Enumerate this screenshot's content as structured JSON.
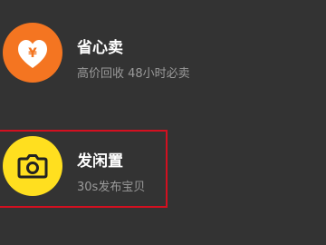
{
  "options": [
    {
      "title": "省心卖",
      "subtitle": "高价回收 48小时必卖",
      "icon": "heart-yen-icon",
      "color": "#f47521"
    },
    {
      "title": "发闲置",
      "subtitle": "30s发布宝贝",
      "icon": "camera-icon",
      "color": "#ffdf1f"
    }
  ],
  "highlight_color": "#d31020"
}
